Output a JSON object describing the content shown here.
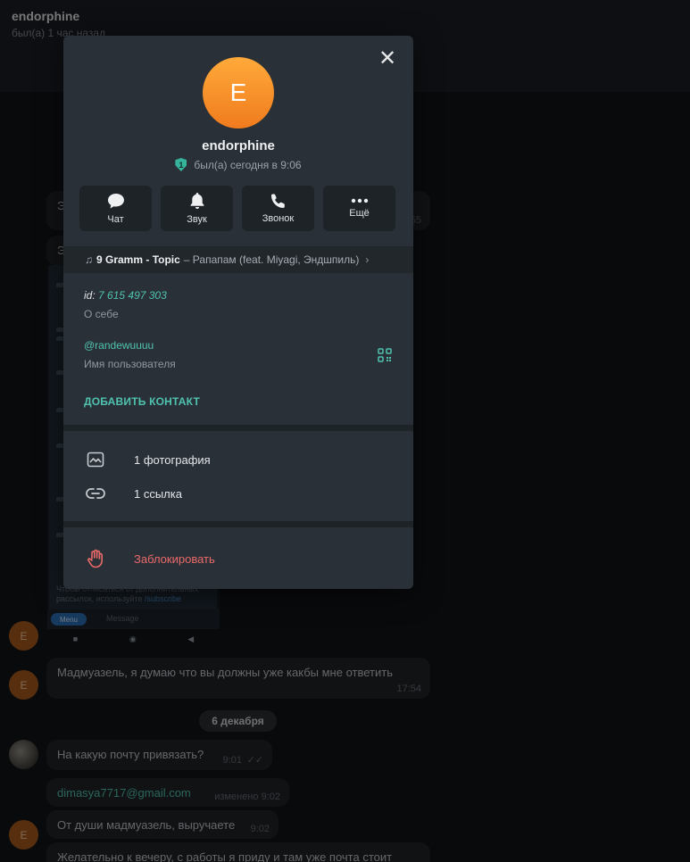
{
  "header": {
    "name": "endorphine",
    "status": "был(а) 1 час назад"
  },
  "chat": {
    "avatar_letter": "E",
    "hidden_bubbles": [
      "Э",
      "Э"
    ],
    "hidden_time": "55",
    "phone_footer": {
      "text": "Чтобы отписаться от дополнительных рассылок, используйте",
      "link": "/subscribe",
      "time": "14:07"
    },
    "phone_bar": {
      "menu": "Menu",
      "message": "Message"
    },
    "msg1": {
      "text": "Мадмуазель, я думаю что вы должны уже какбы мне ответить",
      "time": "17:54"
    },
    "date": "6 декабря",
    "msg2": {
      "text": "На какую почту привязать?",
      "time": "9:01",
      "checks": "✓✓"
    },
    "msg3": {
      "text": "dimasya7717@gmail.com",
      "meta": "изменено 9:02"
    },
    "msg4": {
      "text": "От души мадмуазель, выручаете",
      "time": "9:02"
    },
    "msg5": {
      "text": "Желательно к вечеру, с работы я приду и там уже почта стоит"
    }
  },
  "profile": {
    "avatar_letter": "E",
    "name": "endorphine",
    "badge": "1",
    "status": "был(а) сегодня в 9:06",
    "actions": [
      {
        "label": "Чат",
        "icon": "chat-bubble-icon"
      },
      {
        "label": "Звук",
        "icon": "bell-icon"
      },
      {
        "label": "Звонок",
        "icon": "phone-icon"
      },
      {
        "label": "Ещё",
        "icon": "more-dots-icon"
      }
    ],
    "music": {
      "artist_title": "9 Gramm - Topic",
      "rest": "– Рапапам (feat. Miyagi, Эндшпиль)"
    },
    "id": {
      "label": "id:",
      "value": "7 615 497 303"
    },
    "bio_label": "О себе",
    "username": "@randewuuuu",
    "username_label": "Имя пользователя",
    "add_contact": "ДОБАВИТЬ КОНТАКТ",
    "media": [
      {
        "label": "1 фотография",
        "icon": "photo-icon"
      },
      {
        "label": "1 ссылка",
        "icon": "link-icon"
      }
    ],
    "block": {
      "label": "Заблокировать",
      "icon": "hand-stop-icon"
    }
  },
  "colors": {
    "accent": "#4fc3b0",
    "danger": "#ea6a6a",
    "avatar": "#f59531"
  }
}
